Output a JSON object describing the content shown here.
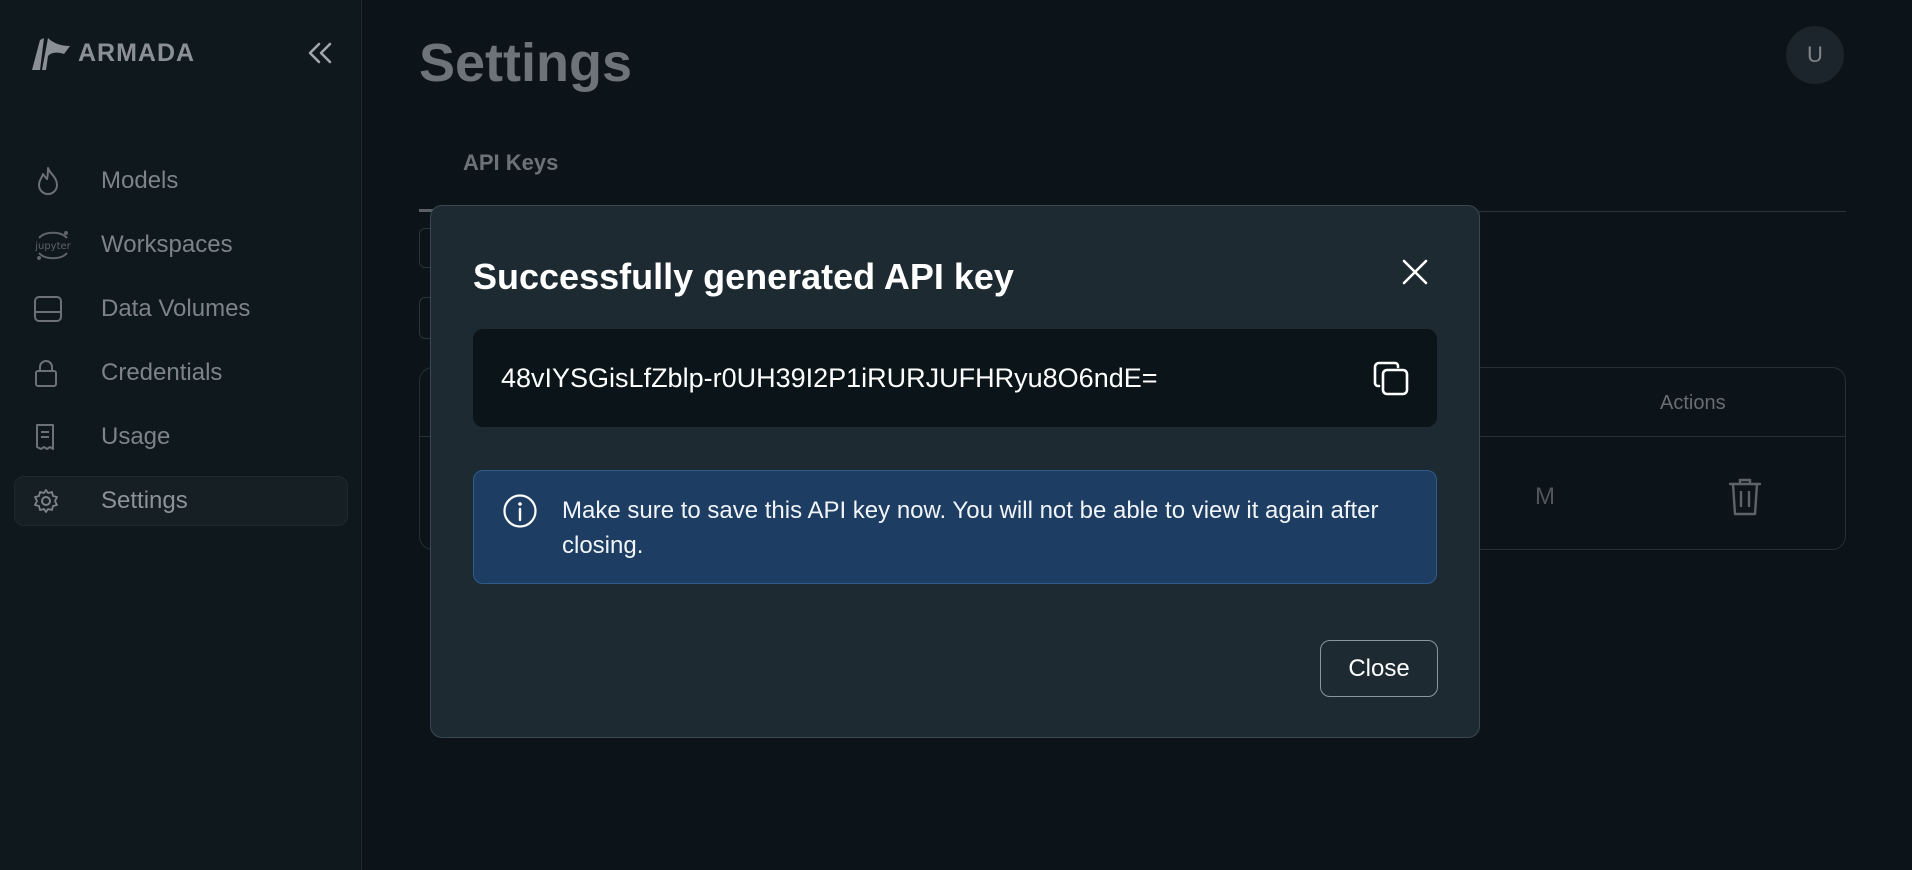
{
  "app": {
    "brand": "ARMADA"
  },
  "sidebar": {
    "collapse_icon": "chevrons-left-icon",
    "items": [
      {
        "label": "Models",
        "icon": "flame-icon",
        "active": false
      },
      {
        "label": "Workspaces",
        "icon": "jupyter-icon",
        "active": false
      },
      {
        "label": "Data Volumes",
        "icon": "hard-drive-icon",
        "active": false
      },
      {
        "label": "Credentials",
        "icon": "lock-icon",
        "active": false
      },
      {
        "label": "Usage",
        "icon": "receipt-icon",
        "active": false
      },
      {
        "label": "Settings",
        "icon": "gear-icon",
        "active": true
      }
    ]
  },
  "header": {
    "title": "Settings",
    "avatar_initial": "U"
  },
  "tabs": [
    {
      "label": "API Keys",
      "active": true
    }
  ],
  "table": {
    "headers": {
      "actions": "Actions"
    },
    "row": {
      "date_fragment": "M"
    }
  },
  "modal": {
    "title": "Successfully generated API key",
    "api_key": "48vIYSGisLfZblp-r0UH39I2P1iRURJUFHRyu8O6ndE=",
    "info_message": "Make sure to save this API key now. You will not be able to view it again after closing.",
    "close_label": "Close"
  },
  "colors": {
    "background": "#0c1419",
    "modal": "#1d2a32",
    "info_bg": "#1e3d63",
    "info_border": "#2f5a8c"
  }
}
